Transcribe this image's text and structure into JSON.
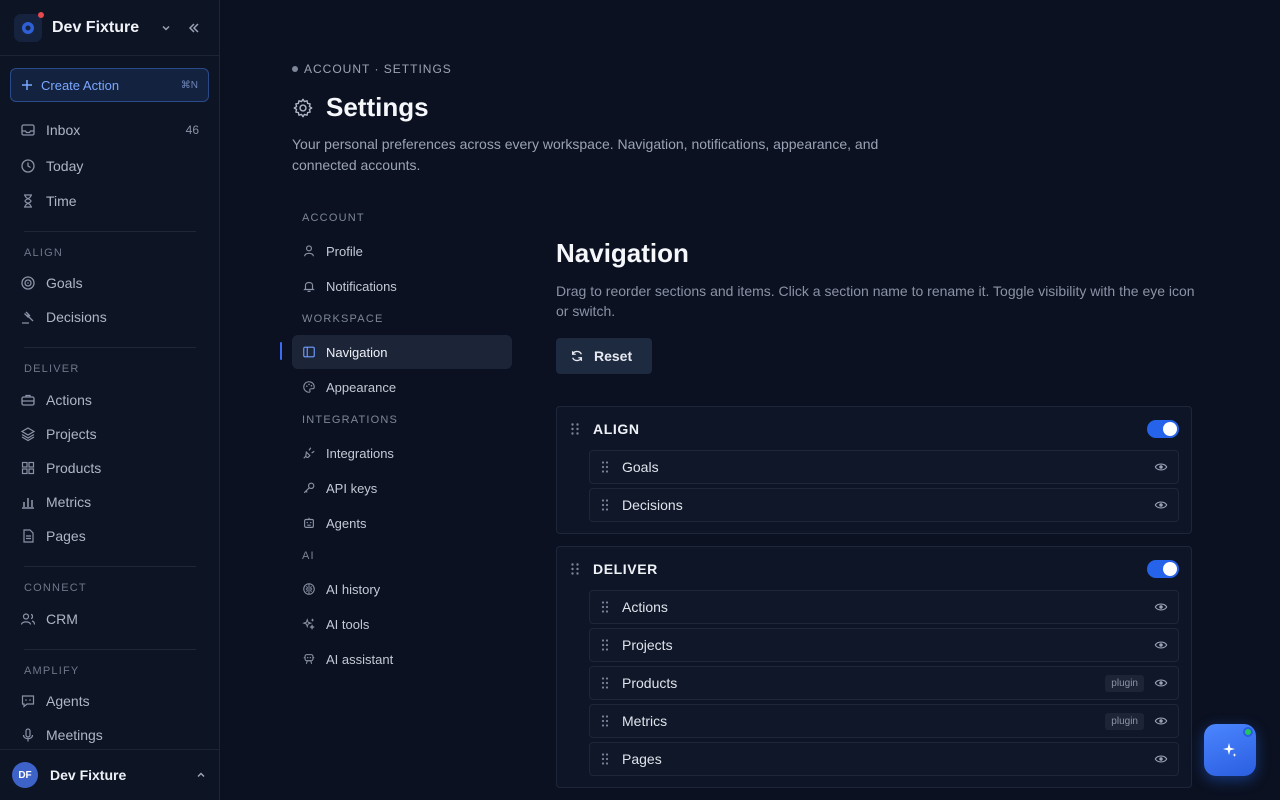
{
  "workspace": {
    "name": "Dev Fixture"
  },
  "create_action": {
    "label": "Create Action",
    "shortcut": "⌘N"
  },
  "sidebar": {
    "top_items": [
      {
        "label": "Inbox",
        "count": "46",
        "icon": "inbox-icon"
      },
      {
        "label": "Today",
        "icon": "clock-icon"
      },
      {
        "label": "Time",
        "icon": "hourglass-icon"
      }
    ],
    "sections": [
      {
        "title": "ALIGN",
        "items": [
          {
            "label": "Goals",
            "icon": "target-icon"
          },
          {
            "label": "Decisions",
            "icon": "gavel-icon"
          }
        ]
      },
      {
        "title": "DELIVER",
        "items": [
          {
            "label": "Actions",
            "icon": "briefcase-icon"
          },
          {
            "label": "Projects",
            "icon": "layers-icon"
          },
          {
            "label": "Products",
            "icon": "grid-icon"
          },
          {
            "label": "Metrics",
            "icon": "bar-chart-icon"
          },
          {
            "label": "Pages",
            "icon": "file-icon"
          }
        ]
      },
      {
        "title": "CONNECT",
        "items": [
          {
            "label": "CRM",
            "icon": "users-icon"
          }
        ]
      },
      {
        "title": "AMPLIFY",
        "items": [
          {
            "label": "Agents",
            "icon": "message-bot-icon"
          },
          {
            "label": "Meetings",
            "icon": "mic-icon"
          }
        ]
      }
    ]
  },
  "user": {
    "initials": "DF",
    "name": "Dev Fixture"
  },
  "breadcrumb": "ACCOUNT · SETTINGS",
  "page": {
    "title": "Settings",
    "description": "Your personal preferences across every workspace. Navigation, notifications, appearance, and connected accounts."
  },
  "settings_nav": [
    {
      "title": "ACCOUNT",
      "items": [
        {
          "label": "Profile"
        },
        {
          "label": "Notifications"
        }
      ]
    },
    {
      "title": "WORKSPACE",
      "items": [
        {
          "label": "Navigation",
          "active": true
        },
        {
          "label": "Appearance"
        }
      ]
    },
    {
      "title": "INTEGRATIONS",
      "items": [
        {
          "label": "Integrations"
        },
        {
          "label": "API keys"
        },
        {
          "label": "Agents"
        }
      ]
    },
    {
      "title": "AI",
      "items": [
        {
          "label": "AI history"
        },
        {
          "label": "AI tools"
        },
        {
          "label": "AI assistant"
        }
      ]
    }
  ],
  "navigation_panel": {
    "title": "Navigation",
    "description": "Drag to reorder sections and items. Click a section name to rename it. Toggle visibility with the eye icon or switch.",
    "reset_label": "Reset",
    "groups": [
      {
        "name": "ALIGN",
        "enabled": true,
        "items": [
          {
            "name": "Goals"
          },
          {
            "name": "Decisions"
          }
        ]
      },
      {
        "name": "DELIVER",
        "enabled": true,
        "items": [
          {
            "name": "Actions"
          },
          {
            "name": "Projects"
          },
          {
            "name": "Products",
            "badge": "plugin"
          },
          {
            "name": "Metrics",
            "badge": "plugin"
          },
          {
            "name": "Pages"
          }
        ]
      }
    ]
  },
  "colors": {
    "accent": "#2563eb",
    "background": "#0b1120",
    "sidebar": "#0d1424"
  }
}
